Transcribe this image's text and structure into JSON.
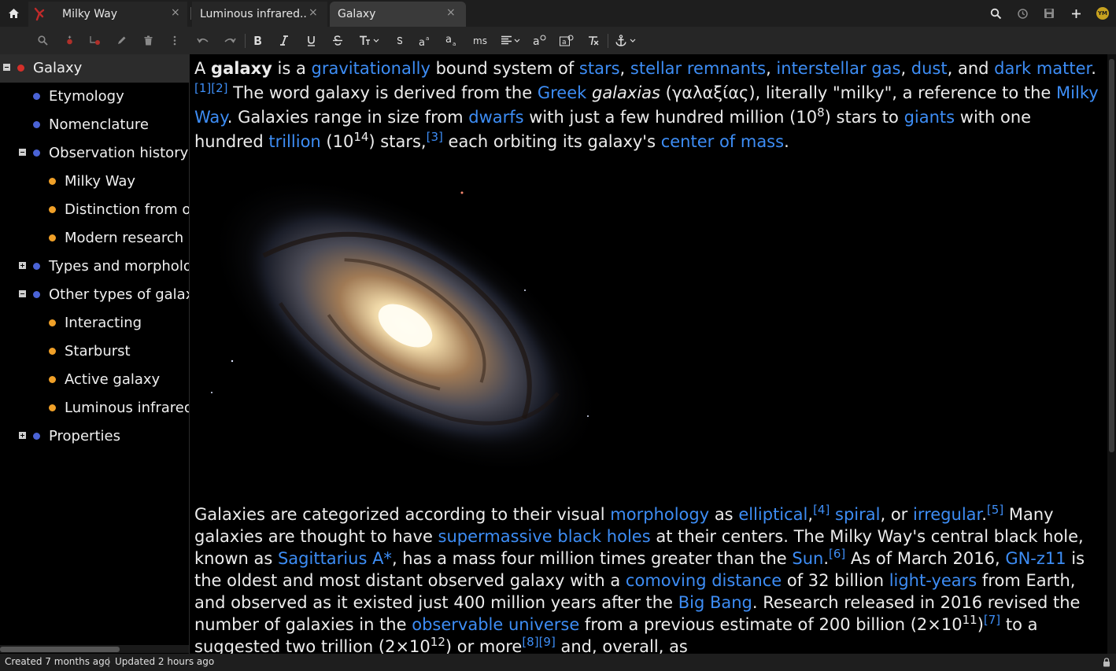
{
  "tabs": [
    {
      "label": "Milky Way",
      "close": "×"
    },
    {
      "label": "Luminous infrared...",
      "close": "×"
    },
    {
      "label": "Galaxy",
      "close": "×"
    }
  ],
  "top_icons": [
    "search-icon",
    "history-icon",
    "save-icon",
    "plus-icon",
    "avatar"
  ],
  "avatar_initials": "YM",
  "toolbar": {
    "ms_label": "ms"
  },
  "tree": [
    {
      "label": "Galaxy",
      "level": 0,
      "toggle": "minus",
      "bullet": "red"
    },
    {
      "label": "Etymology",
      "level": 1,
      "toggle": null,
      "bullet": "blue"
    },
    {
      "label": "Nomenclature",
      "level": 1,
      "toggle": null,
      "bullet": "blue"
    },
    {
      "label": "Observation history",
      "level": 1,
      "toggle": "minus",
      "bullet": "blue"
    },
    {
      "label": "Milky Way",
      "level": 2,
      "toggle": null,
      "bullet": "orange"
    },
    {
      "label": "Distinction from other nebulae",
      "level": 2,
      "toggle": null,
      "bullet": "orange"
    },
    {
      "label": "Modern research",
      "level": 2,
      "toggle": null,
      "bullet": "orange"
    },
    {
      "label": "Types and morphology",
      "level": 1,
      "toggle": "plus",
      "bullet": "blue"
    },
    {
      "label": "Other types of galaxies",
      "level": 1,
      "toggle": "minus",
      "bullet": "blue"
    },
    {
      "label": "Interacting",
      "level": 2,
      "toggle": null,
      "bullet": "orange"
    },
    {
      "label": "Starburst",
      "level": 2,
      "toggle": null,
      "bullet": "orange"
    },
    {
      "label": "Active galaxy",
      "level": 2,
      "toggle": null,
      "bullet": "orange"
    },
    {
      "label": "Luminous infrared galaxies",
      "level": 2,
      "toggle": null,
      "bullet": "orange"
    },
    {
      "label": "Properties",
      "level": 1,
      "toggle": "plus",
      "bullet": "blue"
    }
  ],
  "content": {
    "p1": [
      {
        "t": "A "
      },
      {
        "t": "galaxy",
        "b": true
      },
      {
        "t": " is a "
      },
      {
        "t": "gravitationally",
        "link": true
      },
      {
        "t": " bound system of "
      },
      {
        "t": "stars",
        "link": true
      },
      {
        "t": ", "
      },
      {
        "t": "stellar remnants",
        "link": true
      },
      {
        "t": ", "
      },
      {
        "t": "interstellar gas",
        "link": true
      },
      {
        "t": ", "
      },
      {
        "t": "dust",
        "link": true
      },
      {
        "t": ", and "
      },
      {
        "t": "dark matter",
        "link": true
      },
      {
        "t": "."
      },
      {
        "t": "[1]",
        "link": true,
        "sup": true
      },
      {
        "t": "[2]",
        "link": true,
        "sup": true
      },
      {
        "t": " The word galaxy is derived from the "
      },
      {
        "t": "Greek",
        "link": true
      },
      {
        "t": " "
      },
      {
        "t": "galaxias",
        "i": true
      },
      {
        "t": " (γαλαξίας), literally \"milky\", a reference to the "
      },
      {
        "t": "Milky Way",
        "link": true
      },
      {
        "t": ". Galaxies range in size from "
      },
      {
        "t": "dwarfs",
        "link": true
      },
      {
        "t": " with just a few hundred million (10"
      },
      {
        "t": "8",
        "sup": true
      },
      {
        "t": ") stars to "
      },
      {
        "t": "giants",
        "link": true
      },
      {
        "t": " with one hundred "
      },
      {
        "t": "trillion",
        "link": true
      },
      {
        "t": " (10"
      },
      {
        "t": "14",
        "sup": true
      },
      {
        "t": ") stars,"
      },
      {
        "t": "[3]",
        "link": true,
        "sup": true
      },
      {
        "t": " each orbiting its galaxy's "
      },
      {
        "t": "center of mass",
        "link": true
      },
      {
        "t": "."
      }
    ],
    "p2": [
      {
        "t": "Galaxies are categorized according to their visual "
      },
      {
        "t": "morphology",
        "link": true
      },
      {
        "t": " as "
      },
      {
        "t": "elliptical",
        "link": true
      },
      {
        "t": ","
      },
      {
        "t": "[4]",
        "link": true,
        "sup": true
      },
      {
        "t": " "
      },
      {
        "t": "spiral",
        "link": true
      },
      {
        "t": ", or "
      },
      {
        "t": "irregular",
        "link": true
      },
      {
        "t": "."
      },
      {
        "t": "[5]",
        "link": true,
        "sup": true
      },
      {
        "t": " Many galaxies are thought to have "
      },
      {
        "t": "supermassive black holes",
        "link": true
      },
      {
        "t": " at their centers. The Milky Way's central black hole, known as "
      },
      {
        "t": "Sagittarius A*",
        "link": true
      },
      {
        "t": ", has a mass four million times greater than the "
      },
      {
        "t": "Sun",
        "link": true
      },
      {
        "t": "."
      },
      {
        "t": "[6]",
        "link": true,
        "sup": true
      },
      {
        "t": " As of March 2016, "
      },
      {
        "t": "GN-z11",
        "link": true
      },
      {
        "t": " is the oldest and most distant observed galaxy with a "
      },
      {
        "t": "comoving distance",
        "link": true
      },
      {
        "t": " of 32 billion "
      },
      {
        "t": "light-years",
        "link": true
      },
      {
        "t": " from Earth, and observed as it existed just 400 million years after the "
      },
      {
        "t": "Big Bang",
        "link": true
      },
      {
        "t": "."
      },
      {
        "t": " Research released in 2016 revised the number of galaxies in the "
      },
      {
        "t": "observable universe",
        "link": true
      },
      {
        "t": " from a previous estimate of 200 billion (2×10"
      },
      {
        "t": "11",
        "sup": true
      },
      {
        "t": ")"
      },
      {
        "t": "[7]",
        "link": true,
        "sup": true
      },
      {
        "t": " to a suggested two trillion (2×10"
      },
      {
        "t": "12",
        "sup": true
      },
      {
        "t": ") or more"
      },
      {
        "t": "[8]",
        "link": true,
        "sup": true
      },
      {
        "t": "[9]",
        "link": true,
        "sup": true
      },
      {
        "t": " and, overall, as"
      }
    ]
  },
  "status": {
    "created": "Created 7 months ago",
    "separator": "|",
    "updated": "Updated 2 hours ago"
  },
  "colors": {
    "link": "#3d8df5",
    "bullet_blue": "#4a63d6",
    "bullet_orange": "#f0a028",
    "bullet_red": "#d4302a",
    "avatar": "#c8a21f"
  }
}
